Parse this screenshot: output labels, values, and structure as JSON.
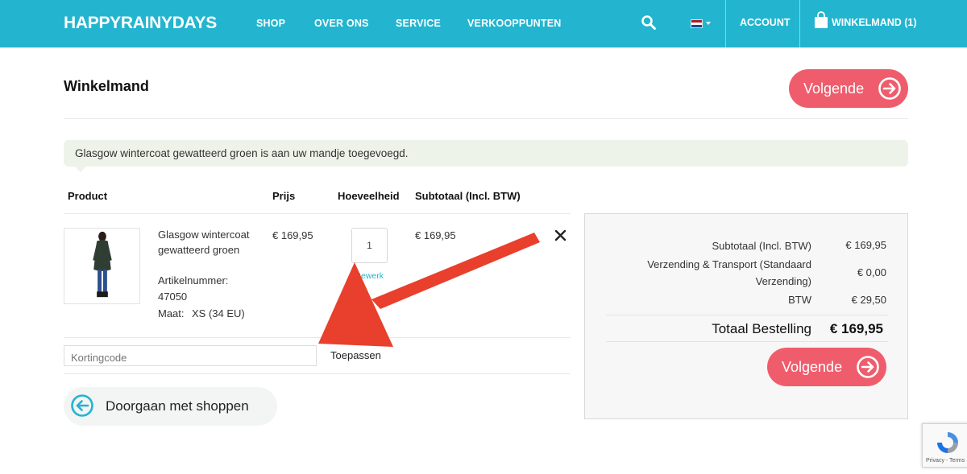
{
  "header": {
    "logo": "HAPPYRAINYDAYS",
    "nav": [
      "SHOP",
      "OVER ONS",
      "SERVICE",
      "VERKOOPPUNTEN"
    ],
    "account": "ACCOUNT",
    "cart": "WINKELMAND (1)",
    "icons": [
      "search-icon",
      "flag-nl-icon",
      "bag-icon"
    ]
  },
  "page": {
    "title": "Winkelmand",
    "next_label": "Volgende",
    "notice": "Glasgow wintercoat gewatteerd groen is aan uw mandje toegevoegd."
  },
  "table": {
    "headers": [
      "Product",
      "Prijs",
      "Hoeveelheid",
      "Subtotaal (Incl. BTW)"
    ],
    "item": {
      "name_line1": "Glasgow wintercoat",
      "name_line2": "gewatteerd groen",
      "sku_label": "Artikelnummer:",
      "sku": "47050",
      "size_label": "Maat:",
      "size": "XS (34 EU)",
      "price": "€ 169,95",
      "quantity": "1",
      "edit_label": "Bewerk",
      "subtotal": "€ 169,95"
    }
  },
  "coupon": {
    "placeholder": "Kortingcode",
    "apply_label": "Toepassen"
  },
  "continue_label": "Doorgaan met shoppen",
  "summary": {
    "subtotal_label": "Subtotaal (Incl. BTW)",
    "subtotal_value": "€ 169,95",
    "shipping_label_line1": "Verzending & Transport (Standaard",
    "shipping_label_line2": "Verzending)",
    "shipping_value": "€ 0,00",
    "tax_label": "BTW",
    "tax_value": "€ 29,50",
    "total_label": "Totaal Bestelling",
    "total_value": "€ 169,95",
    "next_label": "Volgende"
  },
  "recaptcha": {
    "text": "Privacy - Terms"
  },
  "colors": {
    "brand": "#23b5cf",
    "cta": "#ef5d6d",
    "annotation_arrow": "#e8402c"
  }
}
